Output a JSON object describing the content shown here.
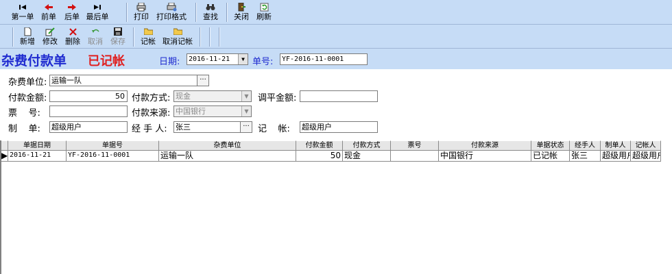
{
  "toolbar1": {
    "first": "第一单",
    "prev": "前单",
    "next": "后单",
    "last": "最后单",
    "print": "打印",
    "print_format": "打印格式",
    "find": "查找",
    "close": "关闭",
    "refresh": "刷新"
  },
  "toolbar2": {
    "new": "新增",
    "edit": "修改",
    "delete": "删除",
    "cancel": "取消",
    "save": "保存",
    "post": "记帐",
    "unpost": "取消记帐"
  },
  "header": {
    "title": "杂费付款单",
    "status": "已记帐",
    "date_label": "日期:",
    "date_value": "2016-11-21",
    "number_label": "单号:",
    "number_value": "YF-2016-11-0001"
  },
  "form": {
    "unit_label": "杂费单位:",
    "unit_value": "运输一队",
    "amount_label": "付款金额:",
    "amount_value": "50",
    "method_label": "付款方式:",
    "method_value": "现金",
    "adjust_label": "调平金额:",
    "adjust_value": "",
    "ticket_label": "票    号:",
    "ticket_value": "",
    "source_label": "付款来源:",
    "source_value": "中国银行",
    "maker_label": "制    单:",
    "maker_value": "超级用户",
    "handler_label": "经 手 人:",
    "handler_value": "张三",
    "poster_label": "记    帐:",
    "poster_value": "超级用户"
  },
  "grid": {
    "columns": [
      "单据日期",
      "单据号",
      "杂费单位",
      "付款金额",
      "付款方式",
      "票号",
      "付款来源",
      "单据状态",
      "经手人",
      "制单人",
      "记帐人"
    ],
    "rows": [
      [
        "2016-11-21",
        "YF-2016-11-0001",
        "运输一队",
        "50",
        "现金",
        "",
        "中国银行",
        "已记帐",
        "张三",
        "超级用户",
        "超级用户"
      ]
    ]
  },
  "icons": {
    "first": "first-record-icon",
    "prev": "prev-record-icon",
    "next": "next-record-icon",
    "last": "last-record-icon",
    "print": "printer-icon",
    "print_format": "print-format-icon",
    "find": "binoculars-icon",
    "close": "close-door-icon",
    "refresh": "refresh-icon",
    "new": "new-document-icon",
    "edit": "edit-icon",
    "delete": "delete-x-icon",
    "cancel": "undo-icon",
    "save": "floppy-disk-icon",
    "post": "folder-icon",
    "unpost": "folder-icon"
  },
  "colors": {
    "toolbar_bg": "#c6dcf6",
    "title": "#1f2bd0",
    "status": "#e02020"
  }
}
